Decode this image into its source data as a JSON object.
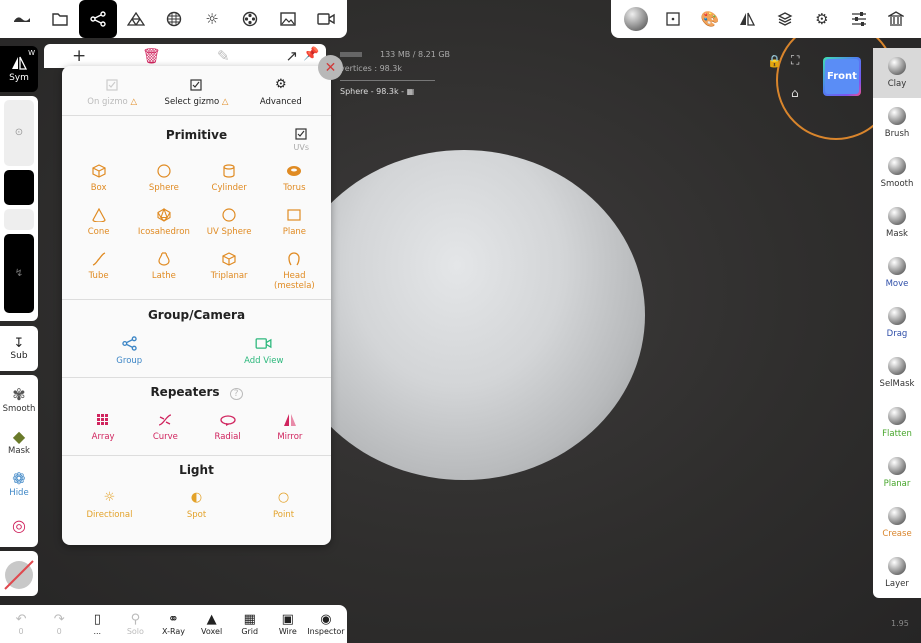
{
  "topbar": {
    "left_icons": [
      "sculptgl-logo-icon",
      "folder-icon",
      "scene-graph-icon",
      "topology-icon",
      "texture-icon",
      "sun-icon",
      "film-reel-icon",
      "image-icon",
      "video-camera-icon"
    ],
    "right_icons": [
      "material-sphere-icon",
      "dotted-square-icon",
      "palette-icon",
      "mirror-icon",
      "layers-icon",
      "gear-icon",
      "sliders-icon",
      "museum-icon"
    ]
  },
  "viewport": {
    "stats_memory": "133 MB / 8.21 GB",
    "stats_vertices": "vertices : 98.3k",
    "selected_object": "Sphere - 98.3k -",
    "cube_label": "Front",
    "version": "1.95"
  },
  "left": {
    "sym_label": "Sym",
    "sym_sup": "W",
    "sub_label": "Sub",
    "tools": [
      {
        "label": "Smooth",
        "icon": "smooth-icon"
      },
      {
        "label": "Mask",
        "icon": "mask-icon"
      },
      {
        "label": "Hide",
        "icon": "hide-icon"
      },
      {
        "label": "",
        "icon": "picker-icon"
      }
    ]
  },
  "right_tools": [
    {
      "label": "Clay",
      "color": "#333333"
    },
    {
      "label": "Brush",
      "color": "#333333"
    },
    {
      "label": "Smooth",
      "color": "#333333"
    },
    {
      "label": "Mask",
      "color": "#333333"
    },
    {
      "label": "Move",
      "color": "#2d4da8"
    },
    {
      "label": "Drag",
      "color": "#2d4da8"
    },
    {
      "label": "SelMask",
      "color": "#333333"
    },
    {
      "label": "Flatten",
      "color": "#47a62b"
    },
    {
      "label": "Planar",
      "color": "#47a62b"
    },
    {
      "label": "Crease",
      "color": "#d9852c"
    },
    {
      "label": "Layer",
      "color": "#333333"
    }
  ],
  "bottom": {
    "items": [
      {
        "label": "0",
        "icon": "undo-icon",
        "disabled": true
      },
      {
        "label": "0",
        "icon": "redo-icon",
        "disabled": true
      },
      {
        "label": "...",
        "icon": "phone-icon",
        "disabled": false
      },
      {
        "label": "Solo",
        "icon": "search-icon",
        "disabled": true
      },
      {
        "label": "X-Ray",
        "icon": "glasses-icon",
        "disabled": false
      },
      {
        "label": "Voxel",
        "icon": "voxel-icon",
        "disabled": false
      },
      {
        "label": "Grid",
        "icon": "grid-icon",
        "disabled": false
      },
      {
        "label": "Wire",
        "icon": "wire-icon",
        "disabled": false
      },
      {
        "label": "Inspector",
        "icon": "inspector-icon",
        "disabled": false
      }
    ]
  },
  "panel": {
    "header": {
      "on_gizmo": "On gizmo",
      "select_gizmo": "Select gizmo",
      "advanced": "Advanced"
    },
    "primitive_title": "Primitive",
    "uvs_label": "UVs",
    "primitives": [
      "Box",
      "Sphere",
      "Cylinder",
      "Torus",
      "Cone",
      "Icosahedron",
      "UV Sphere",
      "Plane",
      "Tube",
      "Lathe",
      "Triplanar",
      "Head (mestela)"
    ],
    "group_title": "Group/Camera",
    "group_items": [
      "Group",
      "Add View"
    ],
    "repeaters_title": "Repeaters",
    "repeaters": [
      "Array",
      "Curve",
      "Radial",
      "Mirror"
    ],
    "light_title": "Light",
    "lights": [
      "Directional",
      "Spot",
      "Point"
    ]
  },
  "colors": {
    "accent_orange": "#e08b23",
    "repeater_red": "#d0245e",
    "group_blue": "#3d86c6",
    "view_green": "#2cb87c"
  }
}
